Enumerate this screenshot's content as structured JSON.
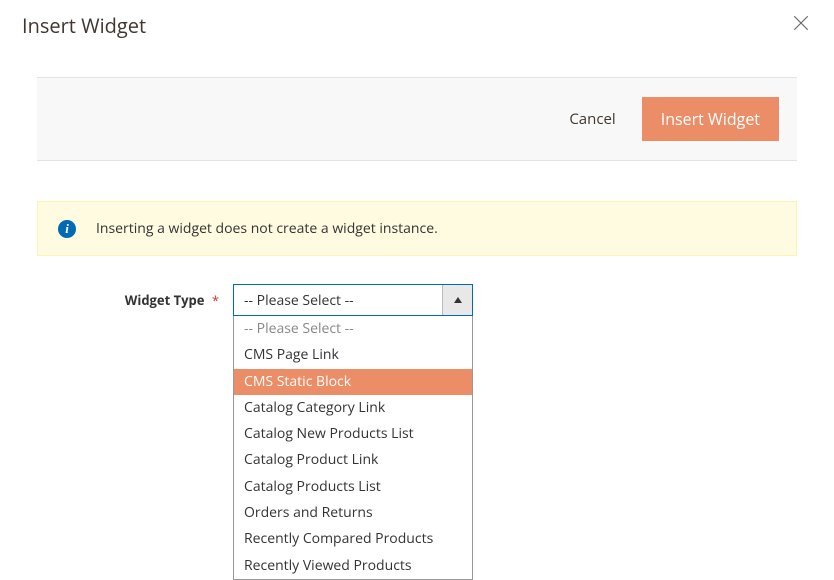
{
  "modal": {
    "title": "Insert Widget"
  },
  "actions": {
    "cancel_label": "Cancel",
    "insert_label": "Insert Widget"
  },
  "info": {
    "message": "Inserting a widget does not create a widget instance.",
    "icon_glyph": "i"
  },
  "form": {
    "widget_type": {
      "label": "Widget Type",
      "required_marker": "*",
      "selected": "-- Please Select --",
      "options": [
        {
          "label": "-- Please Select --",
          "placeholder": true,
          "highlighted": false
        },
        {
          "label": "CMS Page Link",
          "placeholder": false,
          "highlighted": false
        },
        {
          "label": "CMS Static Block",
          "placeholder": false,
          "highlighted": true
        },
        {
          "label": "Catalog Category Link",
          "placeholder": false,
          "highlighted": false
        },
        {
          "label": "Catalog New Products List",
          "placeholder": false,
          "highlighted": false
        },
        {
          "label": "Catalog Product Link",
          "placeholder": false,
          "highlighted": false
        },
        {
          "label": "Catalog Products List",
          "placeholder": false,
          "highlighted": false
        },
        {
          "label": "Orders and Returns",
          "placeholder": false,
          "highlighted": false
        },
        {
          "label": "Recently Compared Products",
          "placeholder": false,
          "highlighted": false
        },
        {
          "label": "Recently Viewed Products",
          "placeholder": false,
          "highlighted": false
        }
      ]
    }
  }
}
